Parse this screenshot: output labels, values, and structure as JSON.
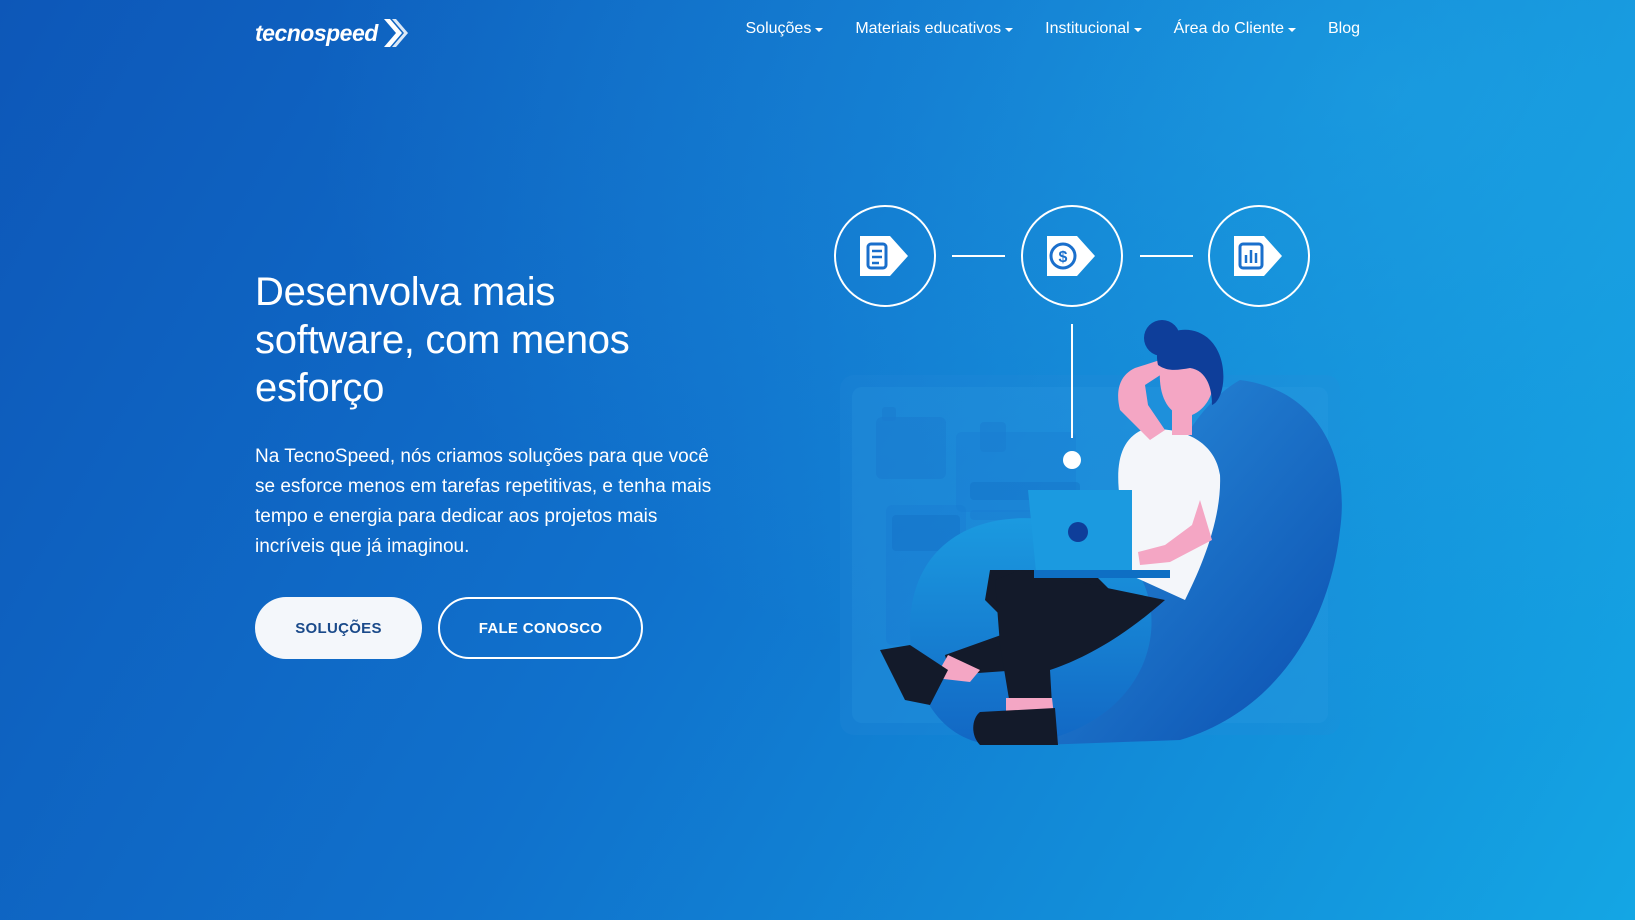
{
  "brand": {
    "name": "tecnospeed"
  },
  "nav": {
    "items": [
      {
        "label": "Soluções",
        "has_dropdown": true
      },
      {
        "label": "Materiais educativos",
        "has_dropdown": true
      },
      {
        "label": "Institucional",
        "has_dropdown": true
      },
      {
        "label": "Área do Cliente",
        "has_dropdown": true
      },
      {
        "label": "Blog",
        "has_dropdown": false
      }
    ]
  },
  "hero": {
    "title": "Desenvolva mais software, com menos esforço",
    "description": "Na TecnoSpeed, nós criamos soluções para que você se esforce menos em tarefas repetitivas, e tenha mais tempo e energia para dedicar aos projetos mais incríveis que já imaginou.",
    "primary_button": "SOLUÇÕES",
    "secondary_button": "FALE CONOSCO"
  },
  "illustration": {
    "icons": [
      "document-tag-icon",
      "dollar-tag-icon",
      "chart-tag-icon"
    ]
  },
  "colors": {
    "background_start": "#0d57b8",
    "background_end": "#14a6e4",
    "primary_button_bg": "#f4f7fb",
    "primary_button_text": "#1a4a8a",
    "text": "#ffffff"
  }
}
